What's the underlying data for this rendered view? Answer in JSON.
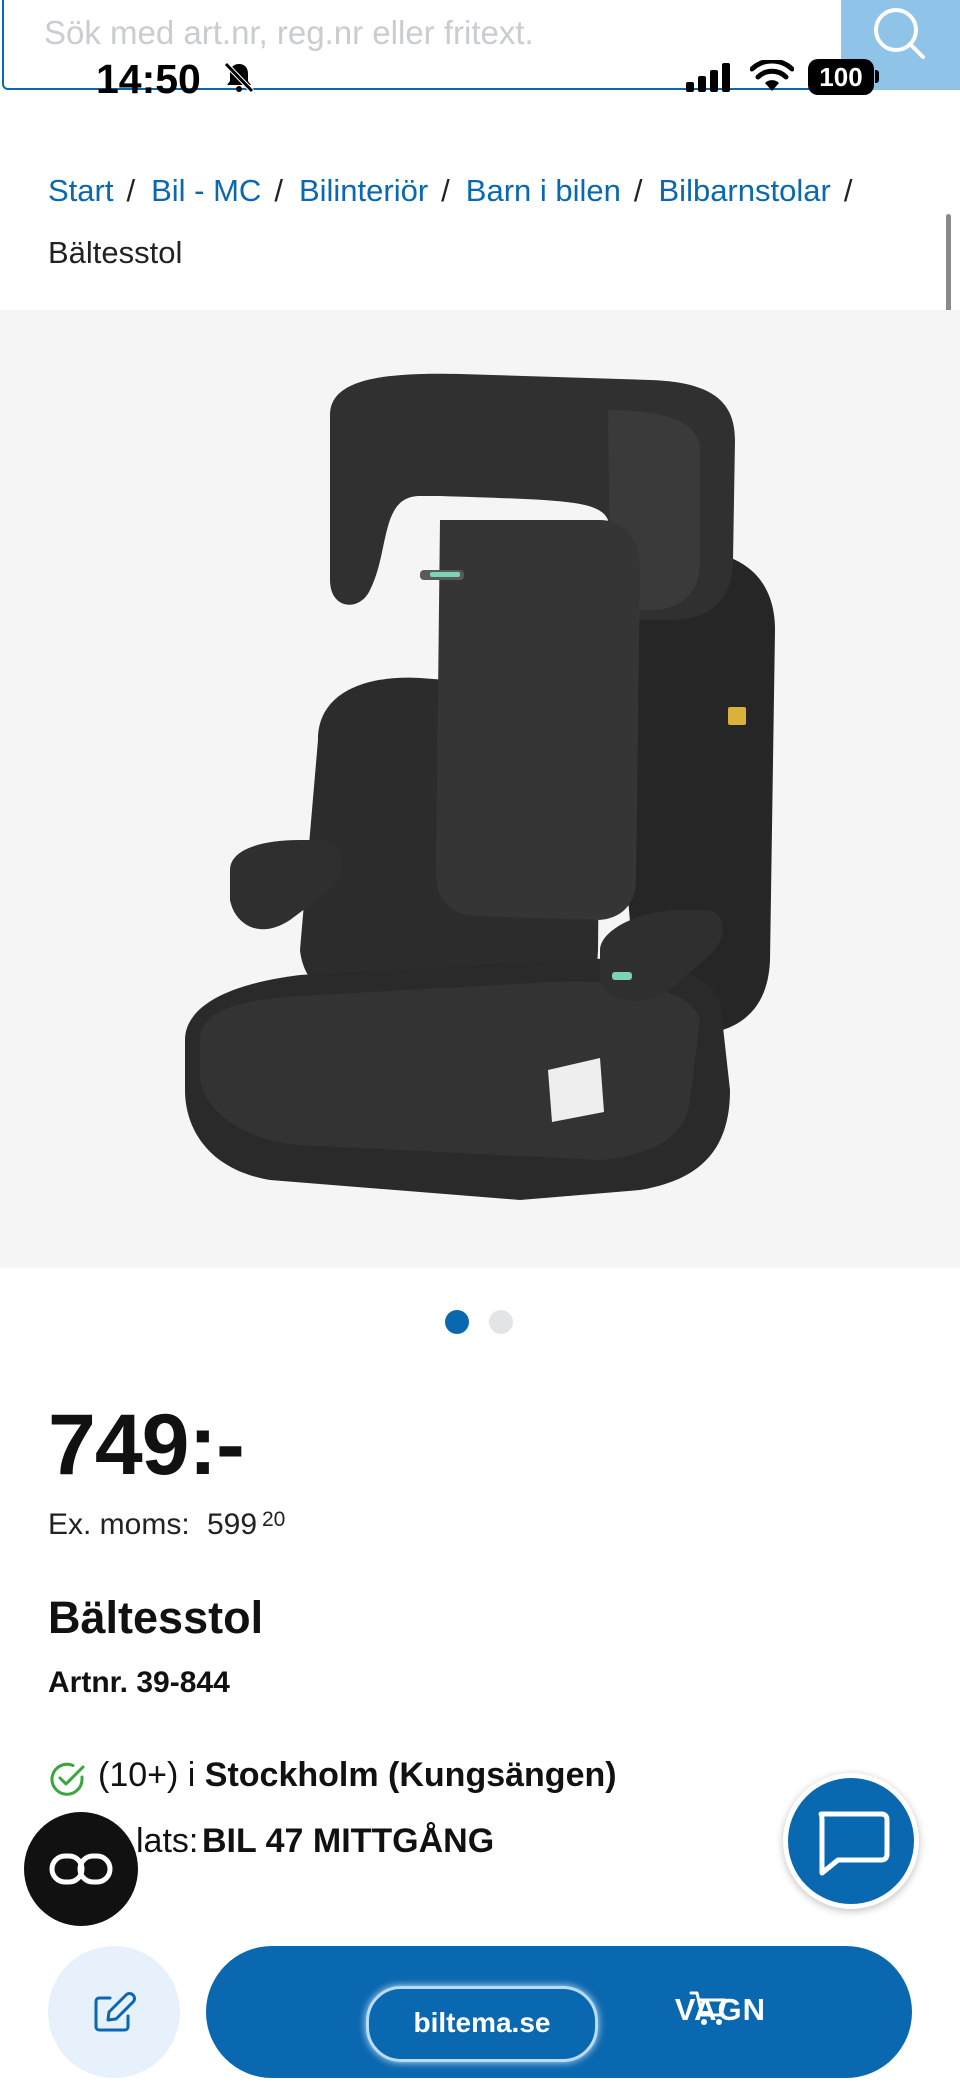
{
  "search": {
    "placeholder": "Sök med art.nr, reg.nr eller fritext."
  },
  "status_bar": {
    "time": "14:50",
    "battery": "100"
  },
  "breadcrumb": {
    "items": [
      "Start",
      "Bil - MC",
      "Bilinteriör",
      "Barn i bilen",
      "Bilbarnstolar"
    ],
    "current": "Bältesstol"
  },
  "gallery": {
    "image_count": 2,
    "active_index": 0
  },
  "product": {
    "price": "749:-",
    "ex_moms_label": "Ex. moms:",
    "ex_moms_value": "599",
    "ex_moms_decimals": "20",
    "title": "Bältesstol",
    "artnr": "Artnr. 39-844"
  },
  "stock": {
    "count": "(10+) i",
    "store": "Stockholm (Kungsängen)",
    "shelf_label": "Hyllplats:",
    "shelf_label_visible": "lats:",
    "shelf_value": "BIL 47 MITTGÅNG"
  },
  "actions": {
    "cart_label": "LÄGG I KUNDVAGN",
    "cart_label_visible": "VAGN"
  },
  "browser": {
    "url": "biltema.se"
  },
  "colors": {
    "brand_blue": "#0a68b0",
    "light_blue": "#8fc3e8",
    "stock_green": "#3aa53a"
  }
}
